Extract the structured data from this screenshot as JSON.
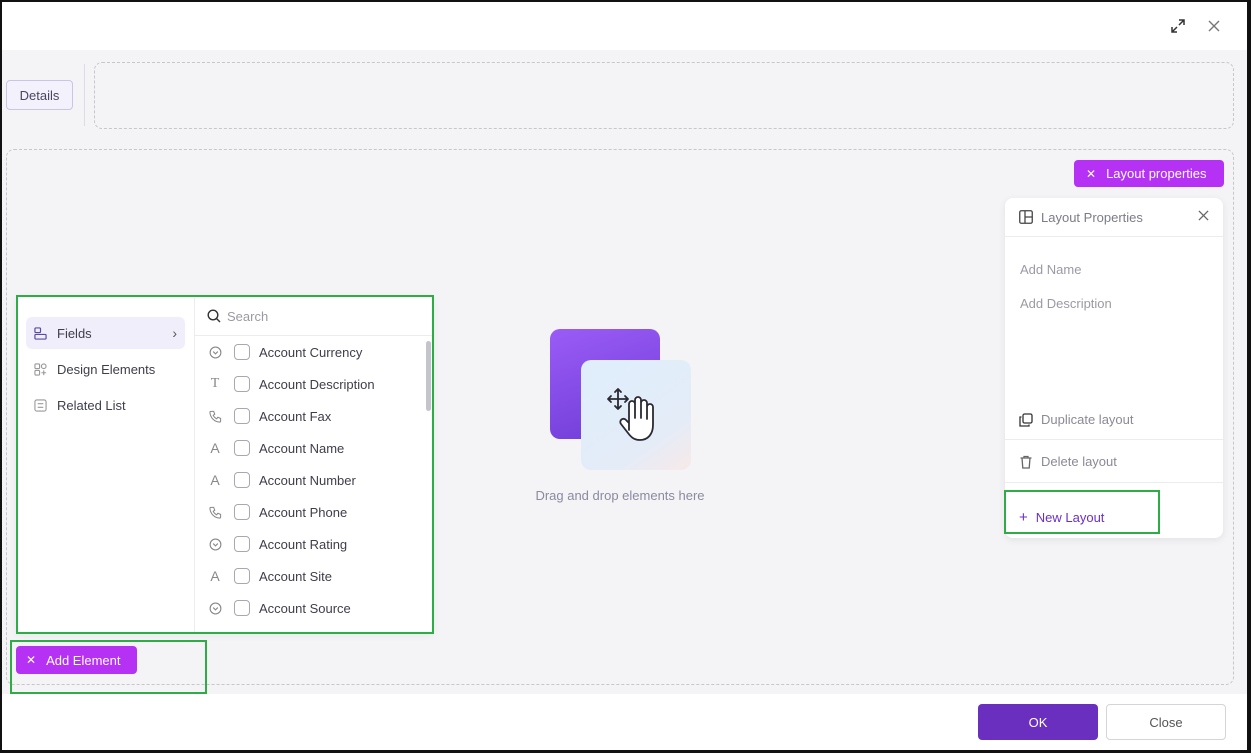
{
  "topbar": {
    "expand_icon": "expand-arrows-icon",
    "close_icon": "close-icon"
  },
  "tabs": {
    "details_label": "Details"
  },
  "layout_properties": {
    "toggle_label": "Layout properties",
    "panel_title": "Layout Properties",
    "name_placeholder": "Add Name",
    "description_placeholder": "Add Description",
    "duplicate_label": "Duplicate layout",
    "delete_label": "Delete layout",
    "new_layout_label": "New Layout"
  },
  "canvas": {
    "drop_text": "Drag and drop elements here"
  },
  "element_panel": {
    "nav": [
      {
        "label": "Fields",
        "icon": "field-icon"
      },
      {
        "label": "Design Elements",
        "icon": "design-elements-icon"
      },
      {
        "label": "Related List",
        "icon": "related-list-icon"
      }
    ],
    "search_placeholder": "Search",
    "fields": [
      {
        "label": "Account Currency",
        "type": "picklist"
      },
      {
        "label": "Account Description",
        "type": "text-area"
      },
      {
        "label": "Account Fax",
        "type": "phone"
      },
      {
        "label": "Account Name",
        "type": "text"
      },
      {
        "label": "Account Number",
        "type": "text"
      },
      {
        "label": "Account Phone",
        "type": "phone"
      },
      {
        "label": "Account Rating",
        "type": "picklist"
      },
      {
        "label": "Account Site",
        "type": "text"
      },
      {
        "label": "Account Source",
        "type": "picklist"
      }
    ]
  },
  "add_element_label": "Add Element",
  "footer": {
    "ok_label": "OK",
    "close_label": "Close"
  },
  "colors": {
    "accent": "#b532f5",
    "primary": "#6b2fbf",
    "highlight": "#2ead47"
  }
}
